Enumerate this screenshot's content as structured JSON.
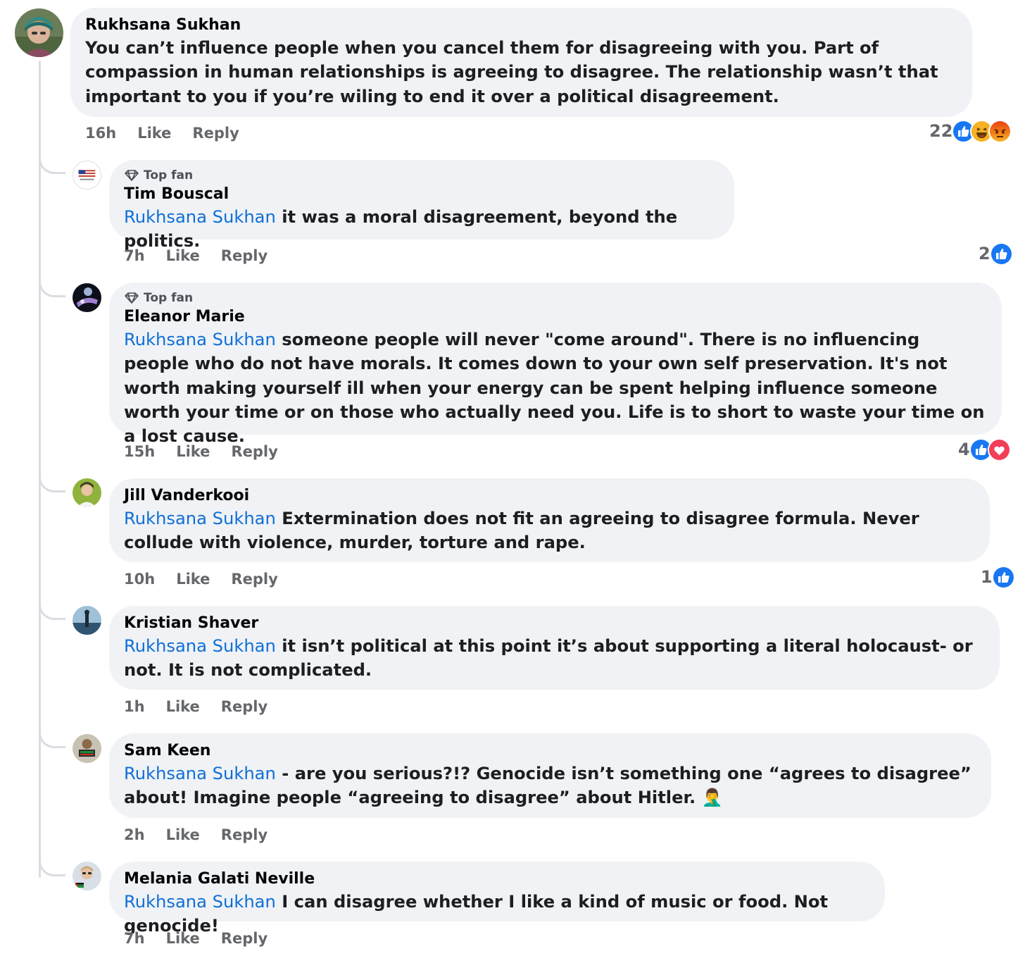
{
  "colors": {
    "bubble_bg": "#f0f2f5",
    "mention": "#0f6fd6",
    "meta": "#65676b",
    "like_blue": "#1877f2",
    "love_red": "#f33e58",
    "angry_orange": "#e9710f"
  },
  "comments": [
    {
      "author": "Rukhsana Sukhan",
      "mention": "",
      "text": "You can’t influence people when you cancel them for disagreeing with you. Part of compassion in human relationships is agreeing to disagree. The relationship wasn’t that important to you if you’re wiling to end it over a political disagreement.",
      "time": "16h",
      "like_label": "Like",
      "reply_label": "Reply",
      "reaction_count": "22",
      "reactions": [
        "like-icon",
        "haha-icon",
        "angry-icon"
      ],
      "avatar_icon": "user-avatar-icon"
    },
    {
      "badge": "Top fan",
      "author": "Tim Bouscal",
      "mention": "Rukhsana Sukhan",
      "text": " it was a moral disagreement, beyond the politics.",
      "time": "7h",
      "like_label": "Like",
      "reply_label": "Reply",
      "reaction_count": "2",
      "reactions": [
        "like-icon"
      ],
      "avatar_icon": "flag-avatar-icon"
    },
    {
      "badge": "Top fan",
      "author": "Eleanor Marie",
      "mention": "Rukhsana Sukhan",
      "text": " someone people will never \"come around\". There is no influencing people who do not have morals. It comes down to your own self preservation. It's not worth making yourself ill when your energy can be spent helping influence someone worth your time or on those who actually need you. Life is to short to waste your time on a lost cause.",
      "time": "15h",
      "like_label": "Like",
      "reply_label": "Reply",
      "reaction_count": "4",
      "reactions": [
        "like-icon",
        "love-icon"
      ],
      "avatar_icon": "user-avatar-icon"
    },
    {
      "author": "Jill Vanderkooi",
      "mention": "Rukhsana Sukhan",
      "text": " Extermination does not fit an agreeing to disagree formula. Never collude with violence, murder, torture and rape.",
      "time": "10h",
      "like_label": "Like",
      "reply_label": "Reply",
      "reaction_count": "1",
      "reactions": [
        "like-icon"
      ],
      "avatar_icon": "user-avatar-icon"
    },
    {
      "author": "Kristian Shaver",
      "mention": "Rukhsana Sukhan",
      "text": " it isn’t political at this point it’s about supporting a literal holocaust- or not. It is not complicated.",
      "time": "1h",
      "like_label": "Like",
      "reply_label": "Reply",
      "avatar_icon": "user-avatar-icon"
    },
    {
      "author": "Sam Keen",
      "mention": "Rukhsana Sukhan",
      "text": " - are you serious?!? Genocide isn’t something one “agrees to disagree” about! Imagine people “agreeing to disagree” about Hitler. 🤦‍♂️",
      "time": "2h",
      "like_label": "Like",
      "reply_label": "Reply",
      "avatar_icon": "user-avatar-icon"
    },
    {
      "author": "Melania Galati Neville",
      "mention": "Rukhsana Sukhan",
      "text": " I can disagree whether I like a kind of music or food. Not genocide!",
      "time": "7h",
      "like_label": "Like",
      "reply_label": "Reply",
      "avatar_icon": "user-avatar-icon"
    }
  ]
}
